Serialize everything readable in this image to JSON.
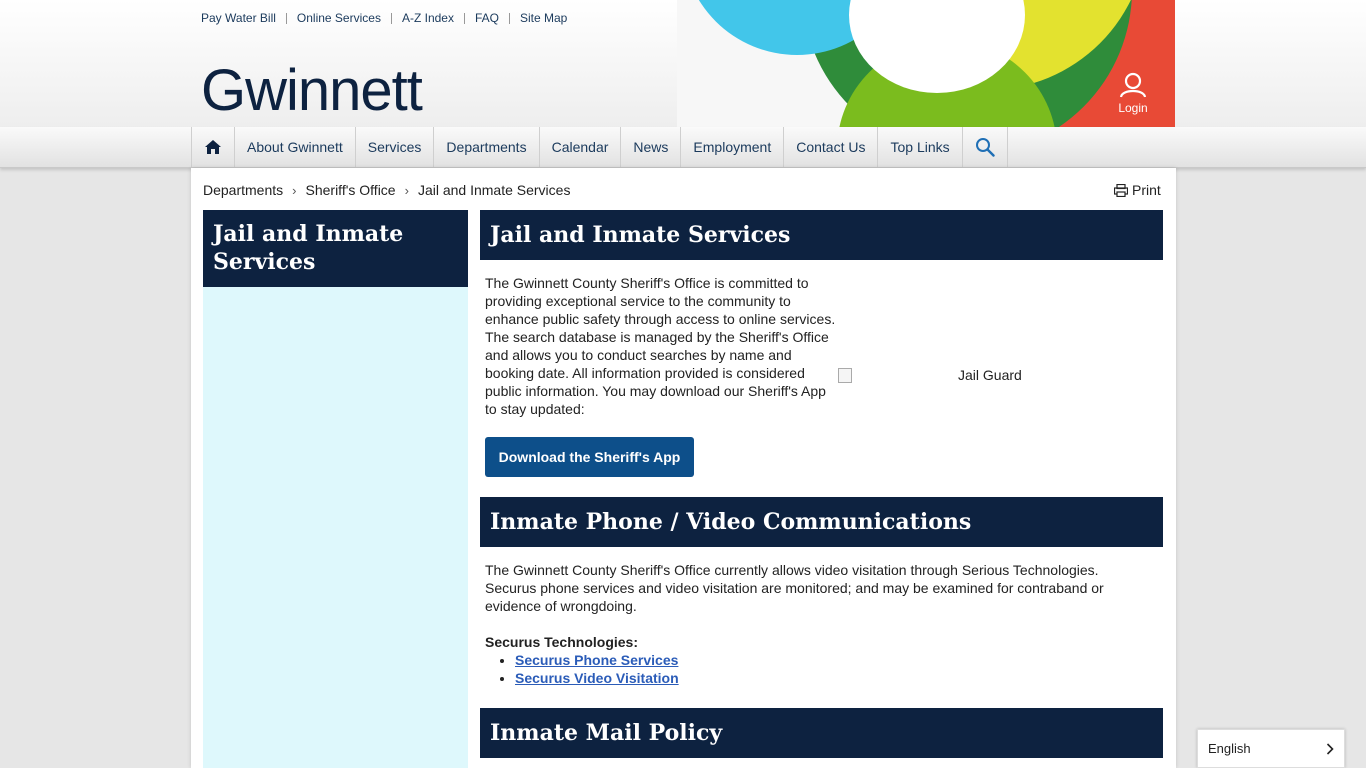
{
  "utility_links": [
    "Pay Water Bill",
    "Online Services",
    "A-Z Index",
    "FAQ",
    "Site Map"
  ],
  "logo_text": "Gwinnett",
  "login_label": "Login",
  "nav": [
    "About Gwinnett",
    "Services",
    "Departments",
    "Calendar",
    "News",
    "Employment",
    "Contact Us",
    "Top Links"
  ],
  "breadcrumb": [
    "Departments",
    "Sheriff's Office",
    "Jail and Inmate Services"
  ],
  "print_label": "Print",
  "sidebar_title": "Jail and Inmate Services",
  "sections": [
    {
      "title": "Jail and Inmate Services",
      "lines": [
        "The Gwinnett County Sheriff's Office is committed to",
        "providing exceptional service to the community to",
        "enhance public safety through access to online services.",
        "The search database is managed by the Sheriff's Office",
        "and allows you to conduct searches by name and",
        "booking date. All information provided is considered",
        "public information. You may download our Sheriff's App",
        "to stay updated:"
      ],
      "button": "Download the Sheriff's App",
      "image_alt": "Jail Guard"
    },
    {
      "title": "Inmate Phone / Video Communications",
      "lines": [
        "The Gwinnett County Sheriff's Office currently allows video visitation through Serious Technologies.",
        "Securus phone services and video visitation are monitored; and may be examined for contraband or",
        "evidence of wrongdoing."
      ],
      "subheading": "Securus Technologies:",
      "links": [
        "Securus Phone Services",
        "Securus Video Visitation"
      ]
    },
    {
      "title": "Inmate Mail Policy"
    }
  ],
  "language": "English",
  "colors": {
    "navy": "#0d2240",
    "button_blue": "#0d4f8a",
    "sidebar_bg": "#def8fc",
    "link": "#2b5cb8"
  }
}
